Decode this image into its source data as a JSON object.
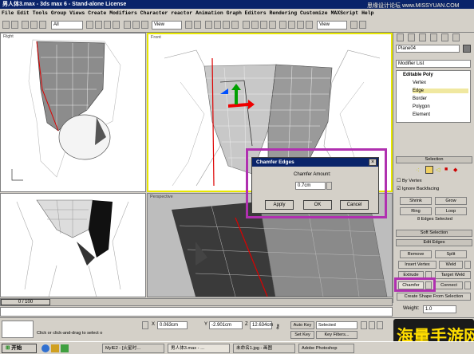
{
  "window": {
    "title": "男人体3.max - 3ds max 6 - Stand-alone License"
  },
  "menu": {
    "items": [
      "File",
      "Edit",
      "Tools",
      "Group",
      "Views",
      "Create",
      "Modifiers",
      "Character",
      "reactor",
      "Animation",
      "Graph Editors",
      "Rendering",
      "Customize",
      "MAXScript",
      "Help"
    ]
  },
  "watermark": "思缘设计论坛 www.MISSYUAN.COM",
  "toolbar": {
    "filter": "All",
    "view": "View",
    "view2": "View"
  },
  "viewports": {
    "top_left": "Right",
    "top_right": "Front",
    "bottom_right": "Perspective"
  },
  "panel": {
    "object_name": "Plane04",
    "modifier_list": "Modifier List",
    "stack": [
      "Editable Poly",
      "Vertex",
      "Edge",
      "Border",
      "Polygon",
      "Element"
    ],
    "selection_header": "Selection",
    "by_vertex": "By Vertex",
    "ignore_backfacing": "Ignore Backfacing",
    "shrink": "Shrink",
    "grow": "Grow",
    "ring": "Ring",
    "loop": "Loop",
    "selected_count": "8 Edges Selected",
    "soft_selection": "Soft Selection",
    "edit_edges": "Edit Edges",
    "remove": "Remove",
    "split": "Split",
    "insert_vertex": "Insert Vertex",
    "weld": "Weld",
    "extrude": "Extrude",
    "target_weld": "Target Weld",
    "chamfer": "Chamfer",
    "connect": "Connect",
    "create_shape": "Create Shape From Selection",
    "weight_label": "Weight:",
    "weight_value": "1.0"
  },
  "dialog": {
    "title": "Chamfer Edges",
    "amount_label": "Chamfer Amount:",
    "amount_value": "0.7cm",
    "apply": "Apply",
    "ok": "OK",
    "cancel": "Cancel"
  },
  "status": {
    "frame": "0 / 100",
    "prompt": "Click or click-and-drag to select o",
    "x": "0.063cm",
    "y": "-2.901cm",
    "z": "12.634cm",
    "auto_key": "Auto Key",
    "selected": "Selected",
    "set_key": "Set Key",
    "key_filters": "Key Filters..."
  },
  "taskbar": {
    "start": "开始",
    "tasks": [
      "MyIE2 - [火星时…",
      "男人体3.max - …",
      "未命名1.jpg - 画图",
      "Adobe Photoshop"
    ]
  },
  "banner": "海量手游网",
  "colors": {
    "title": "#0a246a",
    "highlight": "#b030b0",
    "banner": "#ffdd00"
  }
}
